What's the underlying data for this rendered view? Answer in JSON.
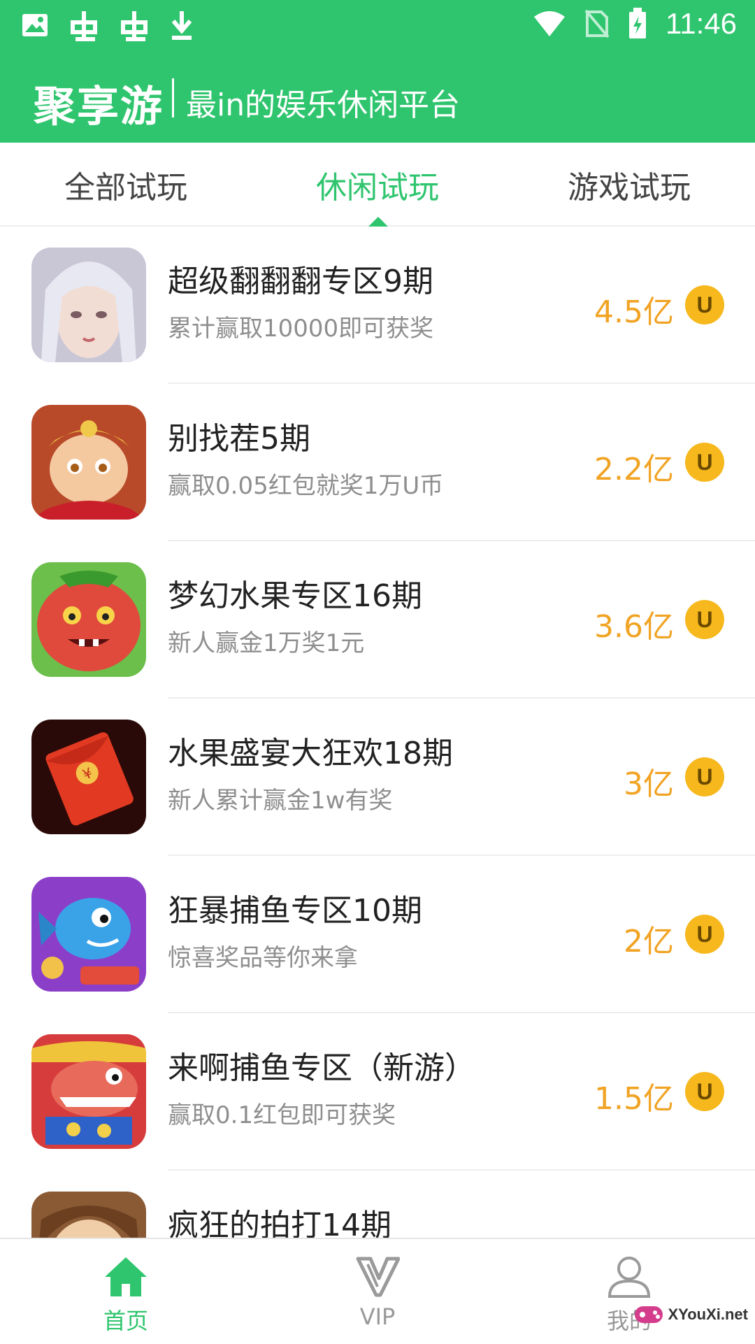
{
  "status_bar": {
    "time": "11:46"
  },
  "header": {
    "brand": "聚享游",
    "slogan": "最in的娱乐休闲平台"
  },
  "tabs": [
    {
      "label": "全部试玩"
    },
    {
      "label": "休闲试玩",
      "active": true
    },
    {
      "label": "游戏试玩"
    }
  ],
  "items": [
    {
      "title": "超级翻翻翻专区9期",
      "subtitle": "累计赢取10000即可获奖",
      "amount": "4.5亿",
      "coin": "U",
      "icon": "fairy-portrait-icon"
    },
    {
      "title": "别找茬5期",
      "subtitle": "赢取0.05红包就奖1万U币",
      "amount": "2.2亿",
      "coin": "U",
      "icon": "monkey-king-icon"
    },
    {
      "title": "梦幻水果专区16期",
      "subtitle": "新人赢金1万奖1元",
      "amount": "3.6亿",
      "coin": "U",
      "icon": "fruit-monster-icon"
    },
    {
      "title": "水果盛宴大狂欢18期",
      "subtitle": "新人累计赢金1w有奖",
      "amount": "3亿",
      "coin": "U",
      "icon": "red-envelope-icon"
    },
    {
      "title": "狂暴捕鱼专区10期",
      "subtitle": "惊喜奖品等你来拿",
      "amount": "2亿",
      "coin": "U",
      "icon": "blue-fish-icon"
    },
    {
      "title": "来啊捕鱼专区（新游）",
      "subtitle": "赢取0.1红包即可获奖",
      "amount": "1.5亿",
      "coin": "U",
      "icon": "shark-icon"
    },
    {
      "title": "疯狂的拍打14期",
      "subtitle": "",
      "amount": "",
      "coin": "",
      "icon": "character-icon"
    }
  ],
  "bottom_nav": [
    {
      "label": "首页",
      "icon": "home-icon",
      "active": true
    },
    {
      "label": "VIP",
      "icon": "vip-icon"
    },
    {
      "label": "我的",
      "icon": "user-icon"
    }
  ],
  "watermark": {
    "text": "XYouXi.net"
  },
  "colors": {
    "brand_green": "#2fc56e",
    "amount_orange": "#f1a323",
    "coin_gold": "#f6b81c"
  }
}
